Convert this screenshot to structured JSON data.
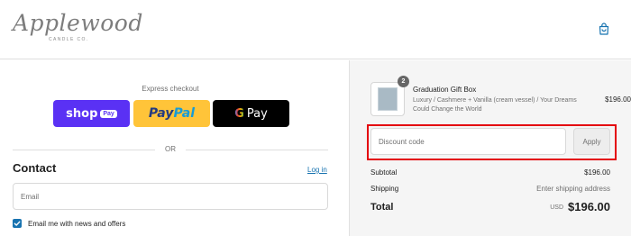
{
  "header": {
    "logo_script": "Applewood",
    "logo_sub": "CANDLE CO.",
    "cart_icon": "shopping-bag-icon"
  },
  "checkout": {
    "express_title": "Express checkout",
    "shop_pay": {
      "word": "shop",
      "tag": "Pay",
      "color": "#5a31f4"
    },
    "paypal": {
      "pay": "Pay",
      "pal": "Pal",
      "color": "#ffc439"
    },
    "gpay": {
      "g": "G",
      "word": "Pay",
      "color": "#000000"
    },
    "divider_text": "OR",
    "contact_title": "Contact",
    "login_label": "Log in",
    "email_placeholder": "Email",
    "newsletter_label": "Email me with news and offers",
    "newsletter_checked": true
  },
  "summary": {
    "item": {
      "quantity": "2",
      "name": "Graduation Gift Box",
      "variant": "Luxury / Cashmere + Vanilla (cream vessel) / Your Dreams Could Change the World",
      "price": "$196.00"
    },
    "discount_placeholder": "Discount code",
    "apply_label": "Apply",
    "subtotal_label": "Subtotal",
    "subtotal_value": "$196.00",
    "shipping_label": "Shipping",
    "shipping_value": "Enter shipping address",
    "total_label": "Total",
    "total_currency": "USD",
    "total_value": "$196.00"
  },
  "colors": {
    "accent": "#1773b0",
    "highlight": "#e4040d",
    "summary_bg": "#f5f5f5"
  }
}
